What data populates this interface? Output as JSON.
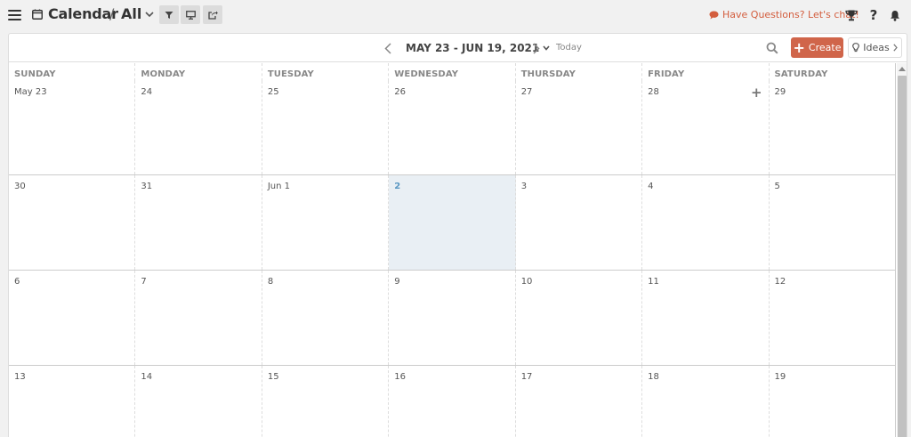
{
  "header": {
    "title": "Calendar",
    "separator": "/",
    "view": "All",
    "chat_link": "Have Questions? Let's chat!"
  },
  "calendar": {
    "range": "MAY 23 - JUN 19, 2021",
    "today_label": "Today",
    "create_label": "Create",
    "ideas_label": "Ideas",
    "days_of_week": [
      "SUNDAY",
      "MONDAY",
      "TUESDAY",
      "WEDNESDAY",
      "THURSDAY",
      "FRIDAY",
      "SATURDAY"
    ],
    "weeks": [
      [
        "May 23",
        "24",
        "25",
        "26",
        "27",
        "28",
        "29"
      ],
      [
        "30",
        "31",
        "Jun 1",
        "2",
        "3",
        "4",
        "5"
      ],
      [
        "6",
        "7",
        "8",
        "9",
        "10",
        "11",
        "12"
      ],
      [
        "13",
        "14",
        "15",
        "16",
        "17",
        "18",
        "19"
      ]
    ],
    "today_date": "2"
  },
  "colors": {
    "accent": "#d0654a",
    "chat_link": "#d35d3d",
    "today_bg": "#e9eff4",
    "today_text": "#5a97c2"
  },
  "icons": {
    "menu": "hamburger-icon",
    "calendar": "calendar-icon",
    "filter": "filter-icon",
    "monitor": "monitor-icon",
    "share": "share-icon",
    "chat": "chat-bubble-icon",
    "trophy": "trophy-icon",
    "help": "question-icon",
    "bell": "bell-icon",
    "search": "search-icon",
    "add": "plus-icon",
    "ideas": "lightbulb-icon"
  }
}
